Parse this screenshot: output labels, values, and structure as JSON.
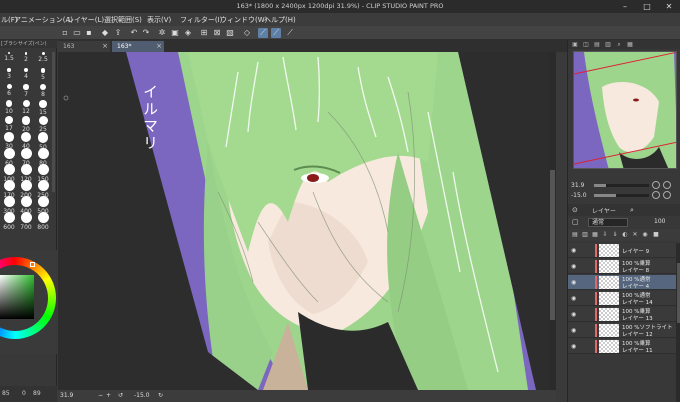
{
  "window": {
    "title": "163* (1800 x 2400px 1200dpi 31.9%) - CLIP STUDIO PAINT PRO"
  },
  "menu": {
    "items": [
      "ル(F)",
      "アニメーション(A)",
      "レイヤー(L)",
      "選択範囲(S)",
      "表示(V)",
      "フィルター(I)",
      "ウィンドウ(W)",
      "ヘルプ(H)"
    ]
  },
  "tabs": [
    {
      "label": "163"
    },
    {
      "label": "163*"
    }
  ],
  "brush_panel": {
    "header": "[ブラシサイズ(ペン)",
    "sizes": [
      "1.5",
      "2",
      "2.5",
      "3",
      "4",
      "5",
      "6",
      "7",
      "8",
      "10",
      "12",
      "15",
      "17",
      "20",
      "25",
      "30",
      "40",
      "50",
      "60",
      "70",
      "80",
      "100",
      "120",
      "150",
      "170",
      "200",
      "250",
      "300",
      "400",
      "500",
      "600",
      "700",
      "800"
    ]
  },
  "left_status": {
    "a": "85",
    "b": "0",
    "c": "89"
  },
  "canvas": {
    "artwork_text": "イルマリ",
    "status": {
      "zoom": "31.9",
      "angle": "-15.0"
    }
  },
  "navigator": {
    "zoom_value": "31.9",
    "angle_value": "-15.0"
  },
  "layer_panel": {
    "tab_label": "レイヤー",
    "blend_mode": "通常",
    "opacity": "100",
    "layers": [
      {
        "mode": "",
        "name": "レイヤー 9",
        "selected": false
      },
      {
        "mode": "100 %乗算",
        "name": "レイヤー 8",
        "selected": false
      },
      {
        "mode": "100 %通常",
        "name": "レイヤー 4",
        "selected": true
      },
      {
        "mode": "100 %通常",
        "name": "レイヤー 14",
        "selected": false
      },
      {
        "mode": "100 %乗算",
        "name": "レイヤー 13",
        "selected": false
      },
      {
        "mode": "100 %ソフトライト",
        "name": "レイヤー 12",
        "selected": false
      },
      {
        "mode": "100 %乗算",
        "name": "レイヤー 11",
        "selected": false
      }
    ]
  },
  "colors": {
    "canvas_bg": "#2d2d2d",
    "panel_bg": "#383838",
    "accent": "#5e7fa6",
    "background_purple": "#7b66c0",
    "hair_green": "#9dd58c",
    "skin": "#f7e9de"
  }
}
